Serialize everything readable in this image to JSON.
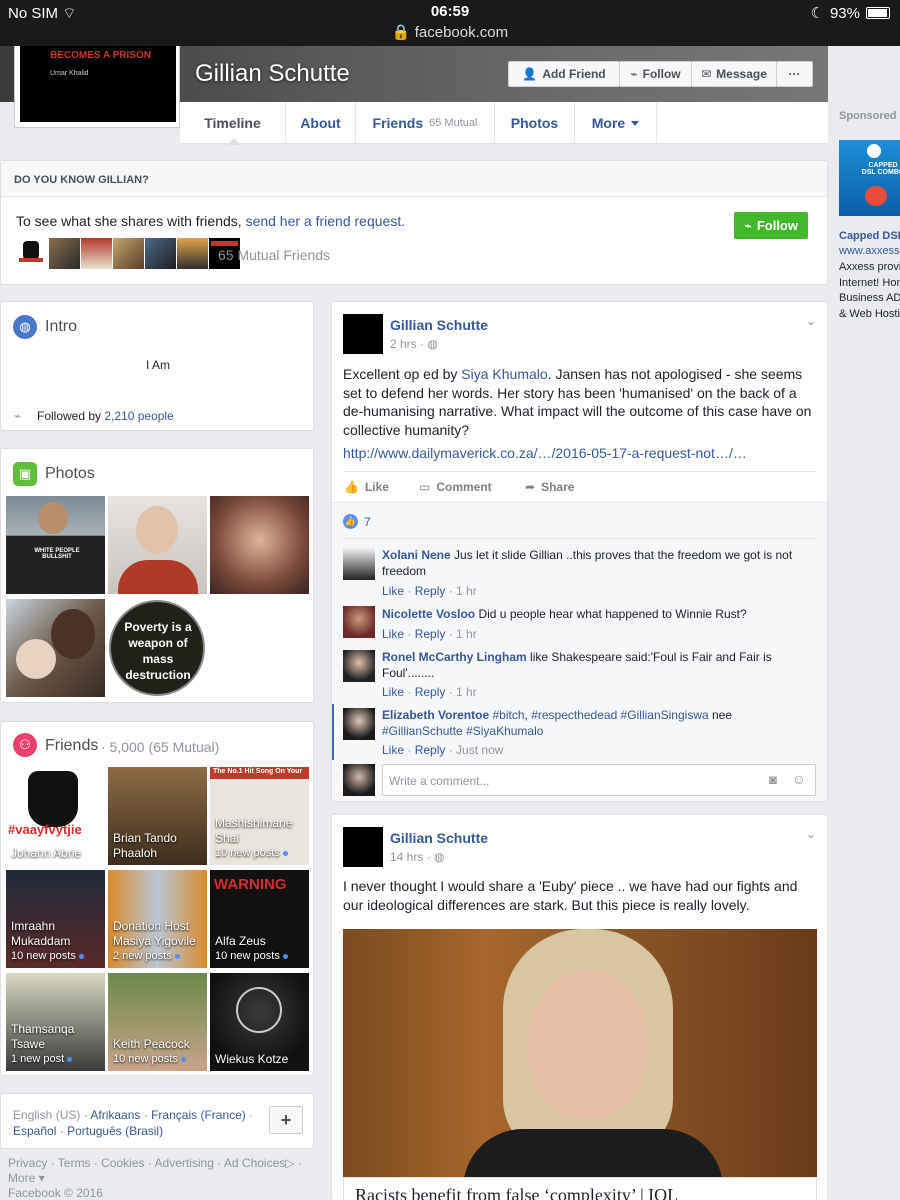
{
  "status_bar": {
    "carrier": "No SIM",
    "time": "06:59",
    "url": "facebook.com",
    "battery": "93%",
    "battery_level": 0.93
  },
  "profile": {
    "name": "Gillian Schutte",
    "avatar_text_line1": "BECOMES A PRISON",
    "avatar_text_line2": "Umar Khalid",
    "buttons": {
      "add_friend": "Add Friend",
      "follow": "Follow",
      "message": "Message",
      "more": "···"
    }
  },
  "tabs": [
    {
      "label": "Timeline"
    },
    {
      "label": "About"
    },
    {
      "label": "Friends",
      "sub": "65 Mutual"
    },
    {
      "label": "Photos"
    },
    {
      "label": "More"
    }
  ],
  "sponsored": {
    "label": "Sponsored",
    "ad_text": "CAPPED DSL COMBO",
    "title": "Capped DSL",
    "url": "www.axxess.",
    "desc": [
      "Axxess provi",
      "Internet! Hon",
      "Business AD",
      "& Web Hostin"
    ]
  },
  "know": {
    "header": "DO YOU KNOW GILLIAN?",
    "text": "To see what she shares with friends,",
    "link": "send her a friend request.",
    "follow": "Follow",
    "mutual": "65 Mutual Friends"
  },
  "intro": {
    "title": "Intro",
    "bio": "I Am",
    "followed_prefix": "Followed by",
    "followed_link": "2,210 people"
  },
  "photos": {
    "title": "Photos",
    "poverty_text": "Poverty is a weapon of mass destruction",
    "shirt_text": "WHITE PEOPLE BULLSHIT"
  },
  "friends": {
    "title": "Friends",
    "count": "· 5,000 (65 Mutual)",
    "items": [
      {
        "name": "Johann Abrie",
        "posts": "",
        "tile_text": "#vaayfvytjie"
      },
      {
        "name": "Brian Tando Phaaloh",
        "posts": ""
      },
      {
        "name": "Mashishimane Shai",
        "posts": "10 new posts",
        "tile_text": "The No.1 Hit Song On Your"
      },
      {
        "name": "Imraahn Mukaddam",
        "posts": "10 new posts"
      },
      {
        "name": "Donation Host Masiya Yigovile",
        "posts": "2 new posts"
      },
      {
        "name": "Alfa Zeus",
        "posts": "10 new posts",
        "tile_text": "WARNING"
      },
      {
        "name": "Thamsanqa Tsawe",
        "posts": "1 new post"
      },
      {
        "name": "Keith Peacock",
        "posts": "10 new posts"
      },
      {
        "name": "Wiekus Kotze",
        "posts": ""
      }
    ]
  },
  "languages": {
    "current": "English (US)",
    "others": [
      "Afrikaans",
      "Français (France)",
      "Español",
      "Português (Brasil)"
    ],
    "add": "+"
  },
  "footer": {
    "links": [
      "Privacy",
      "Terms",
      "Cookies",
      "Advertising",
      "Ad Choices"
    ],
    "more": "More",
    "copyright": "Facebook © 2016"
  },
  "post1": {
    "author": "Gillian Schutte",
    "time": "2 hrs",
    "text_prefix": "Excellent op ed by",
    "text_mention": "Siya Khumalo",
    "text_rest": ". Jansen has not apologised - she seems set to defend her words. Her story has been 'humanised' on the back of a de-humanising narrative. What impact will the outcome of this case have on collective humanity?",
    "link": "http://www.dailymaverick.co.za/…/2016-05-17-a-request-not…/…",
    "actions": {
      "like": "Like",
      "comment": "Comment",
      "share": "Share"
    },
    "likes": "7",
    "comments": [
      {
        "name": "Xolani Nene",
        "text": "Jus let it slide Gillian ..this proves that the freedom we got is not freedom",
        "like": "Like",
        "reply": "Reply",
        "time": "1 hr"
      },
      {
        "name": "Nicolette Vosloo",
        "text": "Did u people hear what happened to Winnie Rust?",
        "like": "Like",
        "reply": "Reply",
        "time": "1 hr"
      },
      {
        "name": "Ronel McCarthy Lingham",
        "text": "like Shakespeare said:'Foul is Fair and Fair is Foul'........",
        "like": "Like",
        "reply": "Reply",
        "time": "1 hr"
      },
      {
        "name": "Elizabeth Vorentoe",
        "tags": [
          "#bitch",
          "#respecthedead",
          "#GillianSingiswa",
          "#GillianSchutte",
          "#SiyaKhumalo"
        ],
        "text_mid": "nee",
        "like": "Like",
        "reply": "Reply",
        "time": "Just now"
      }
    ],
    "comment_placeholder": "Write a comment..."
  },
  "post2": {
    "author": "Gillian Schutte",
    "time": "14 hrs",
    "text": "I never thought I would share a 'Euby' piece .. we have had our fights and our ideological differences are stark. But this piece is really lovely.",
    "link_title": "Racists benefit from false ‘complexity’ | IOL"
  }
}
